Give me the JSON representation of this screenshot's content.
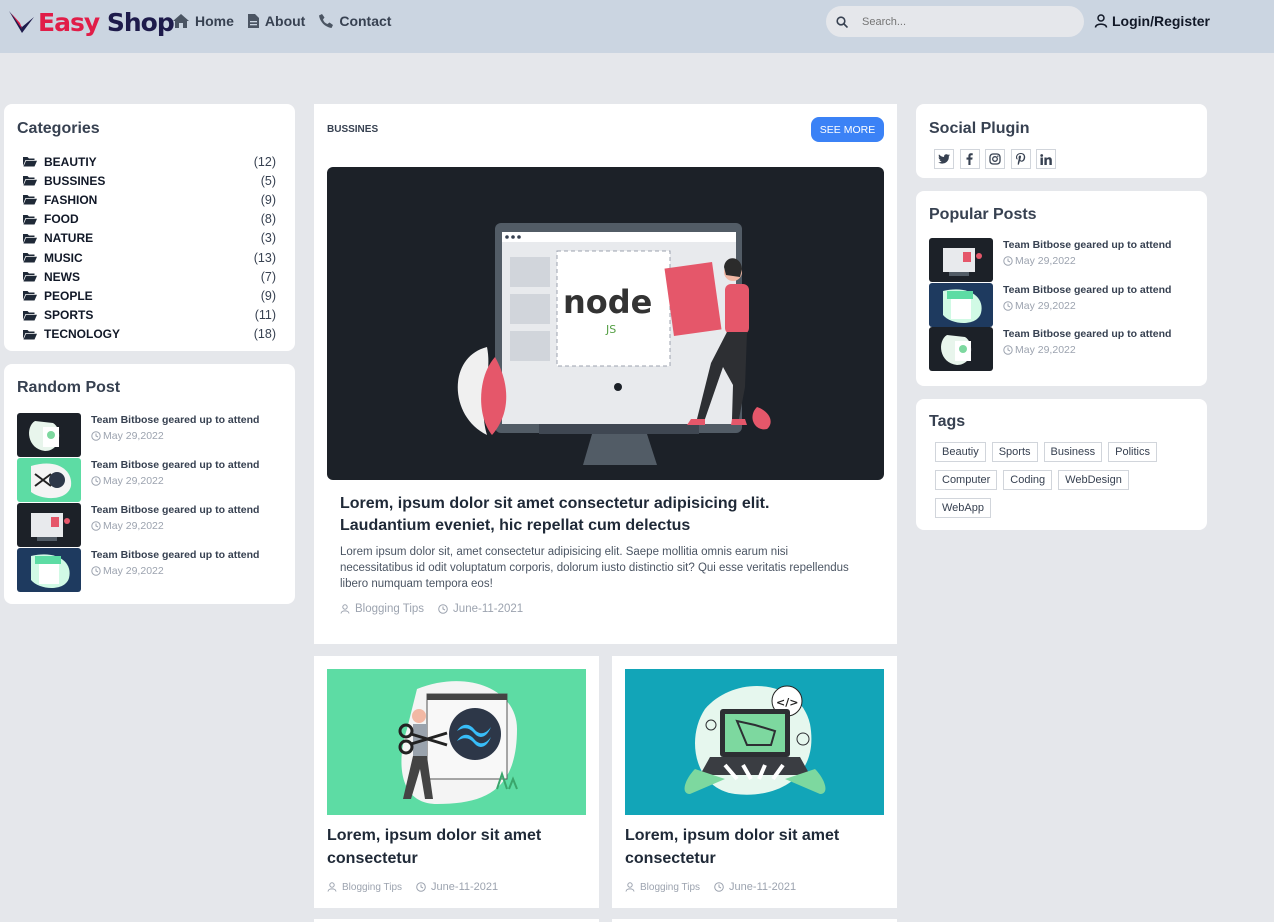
{
  "brand": {
    "easy": "Easy",
    "shop": "Shop"
  },
  "nav": [
    {
      "label": "Home",
      "icon": "home-icon"
    },
    {
      "label": "About",
      "icon": "file-icon"
    },
    {
      "label": "Contact",
      "icon": "phone-icon"
    }
  ],
  "search": {
    "placeholder": "Search..."
  },
  "login": {
    "label": "Login/Register"
  },
  "categories": {
    "title": "Categories",
    "items": [
      {
        "name": "BEAUTIY",
        "count": "(12)"
      },
      {
        "name": "BUSSINES",
        "count": "(5)"
      },
      {
        "name": "FASHION",
        "count": "(9)"
      },
      {
        "name": "FOOD",
        "count": "(8)"
      },
      {
        "name": "NATURE",
        "count": "(3)"
      },
      {
        "name": "MUSIC",
        "count": "(13)"
      },
      {
        "name": "NEWS",
        "count": "(7)"
      },
      {
        "name": "PEOPLE",
        "count": "(9)"
      },
      {
        "name": "SPORTS",
        "count": "(11)"
      },
      {
        "name": "TECNOLOGY",
        "count": "(18)"
      }
    ]
  },
  "random_posts": {
    "title": "Random Post",
    "items": [
      {
        "title": "Team Bitbose geared up to attend",
        "date": "May 29,2022"
      },
      {
        "title": "Team Bitbose geared up to attend",
        "date": "May 29,2022"
      },
      {
        "title": "Team Bitbose geared up to attend",
        "date": "May 29,2022"
      },
      {
        "title": "Team Bitbose geared up to attend",
        "date": "May 29,2022"
      }
    ]
  },
  "main": {
    "section": "BUSSINES",
    "see_more": "SEE MORE",
    "hero_logo": "node",
    "hero_badge": "JS",
    "title": "Lorem, ipsum dolor sit amet consectetur adipisicing elit. Laudantium eveniet, hic repellat cum delectus",
    "text": "Lorem ipsum dolor sit, amet consectetur adipisicing elit. Saepe mollitia omnis earum nisi necessitatibus id odit voluptatum corporis, dolorum iusto distinctio sit? Qui esse veritatis repellendus libero numquam tempora eos!",
    "author": "Blogging Tips",
    "date": "June-11-2021"
  },
  "cards": [
    {
      "title": "Lorem, ipsum dolor sit amet consectetur",
      "author": "Blogging Tips",
      "date": "June-11-2021"
    },
    {
      "title": "Lorem, ipsum dolor sit amet consectetur",
      "author": "Blogging Tips",
      "date": "June-11-2021",
      "badge": "</>"
    }
  ],
  "social": {
    "title": "Social Plugin",
    "icons": [
      "twitter-icon",
      "facebook-icon",
      "instagram-icon",
      "pinterest-icon",
      "linkedin-icon"
    ]
  },
  "popular": {
    "title": "Popular Posts",
    "items": [
      {
        "title": "Team Bitbose geared up to attend",
        "date": "May 29,2022"
      },
      {
        "title": "Team Bitbose geared up to attend",
        "date": "May 29,2022"
      },
      {
        "title": "Team Bitbose geared up to attend",
        "date": "May 29,2022"
      }
    ]
  },
  "tags": {
    "title": "Tags",
    "items": [
      "Beautiy",
      "Sports",
      "Business",
      "Politics",
      "Computer",
      "Coding",
      "WebDesign",
      "WebApp"
    ]
  },
  "colors": {
    "accent": "#3b82f6",
    "header": "#cbd5e1",
    "background": "#e5e7eb",
    "brand_red": "#e11d48",
    "brand_navy": "#1e1b4b"
  }
}
